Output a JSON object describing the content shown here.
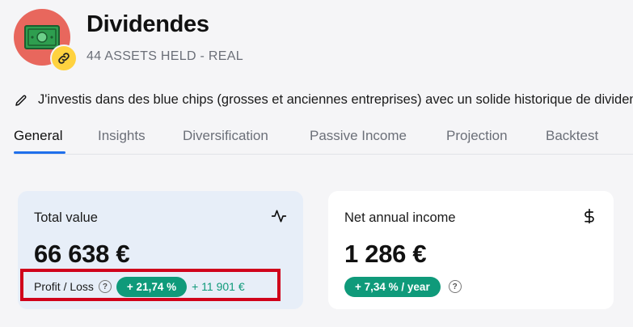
{
  "portfolio": {
    "title": "Dividendes",
    "subtitle": "44 ASSETS HELD - REAL",
    "description": "J'investis dans des blue chips (grosses et anciennes entreprises) avec un solide historique de dividendes"
  },
  "tabs": [
    {
      "label": "General",
      "active": true
    },
    {
      "label": "Insights"
    },
    {
      "label": "Diversification"
    },
    {
      "label": "Passive Income"
    },
    {
      "label": "Projection"
    },
    {
      "label": "Backtest"
    }
  ],
  "cards": {
    "total_value": {
      "label": "Total value",
      "value": "66 638 €",
      "pl_label": "Profit / Loss",
      "pl_percent": "+ 21,74 %",
      "pl_amount": "+ 11 901 €",
      "icon": "activity-icon"
    },
    "net_income": {
      "label": "Net annual income",
      "value": "1 286 €",
      "yield": "+ 7,34 % / year",
      "icon": "dollar-icon"
    }
  },
  "help_glyph": "?",
  "colors": {
    "avatar_bg": "#e8675d",
    "badge_bg": "#ffd23f",
    "gain_green": "#0f9a7a",
    "accent_blue": "#1f6feb",
    "highlight_red": "#d0021b"
  }
}
